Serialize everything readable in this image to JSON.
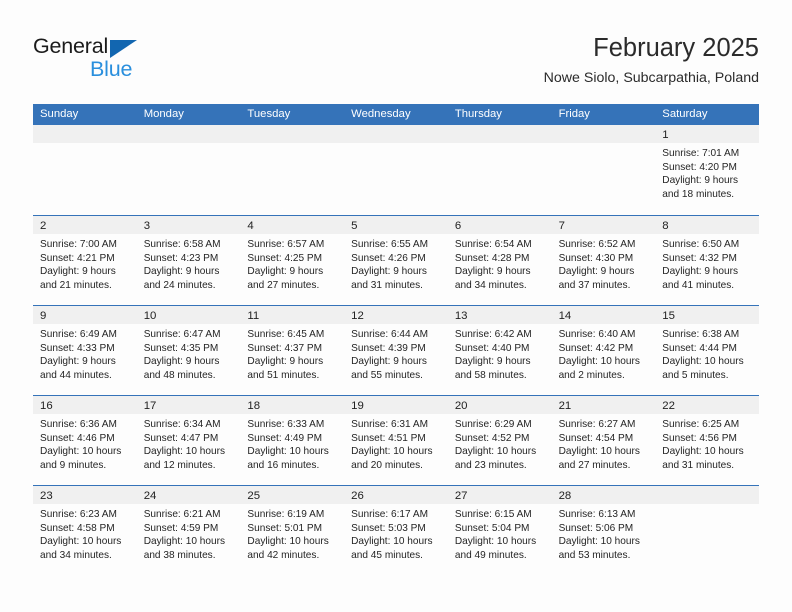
{
  "brand": {
    "name_primary": "General",
    "name_secondary": "Blue",
    "triangle_color": "#1266b0",
    "secondary_color": "#2a8fdd"
  },
  "header": {
    "title": "February 2025",
    "subtitle": "Nowe Siolo, Subcarpathia, Poland"
  },
  "theme": {
    "header_bg": "#3573b9",
    "header_text": "#ffffff",
    "daynum_band_bg": "#f0f0f0",
    "row_border": "#3573b9",
    "page_bg": "#fdfdfd",
    "body_text": "#242424"
  },
  "weekdays": [
    "Sunday",
    "Monday",
    "Tuesday",
    "Wednesday",
    "Thursday",
    "Friday",
    "Saturday"
  ],
  "weeks": [
    [
      {
        "day": "",
        "lines": []
      },
      {
        "day": "",
        "lines": []
      },
      {
        "day": "",
        "lines": []
      },
      {
        "day": "",
        "lines": []
      },
      {
        "day": "",
        "lines": []
      },
      {
        "day": "",
        "lines": []
      },
      {
        "day": "1",
        "lines": [
          "Sunrise: 7:01 AM",
          "Sunset: 4:20 PM",
          "Daylight: 9 hours",
          "and 18 minutes."
        ]
      }
    ],
    [
      {
        "day": "2",
        "lines": [
          "Sunrise: 7:00 AM",
          "Sunset: 4:21 PM",
          "Daylight: 9 hours",
          "and 21 minutes."
        ]
      },
      {
        "day": "3",
        "lines": [
          "Sunrise: 6:58 AM",
          "Sunset: 4:23 PM",
          "Daylight: 9 hours",
          "and 24 minutes."
        ]
      },
      {
        "day": "4",
        "lines": [
          "Sunrise: 6:57 AM",
          "Sunset: 4:25 PM",
          "Daylight: 9 hours",
          "and 27 minutes."
        ]
      },
      {
        "day": "5",
        "lines": [
          "Sunrise: 6:55 AM",
          "Sunset: 4:26 PM",
          "Daylight: 9 hours",
          "and 31 minutes."
        ]
      },
      {
        "day": "6",
        "lines": [
          "Sunrise: 6:54 AM",
          "Sunset: 4:28 PM",
          "Daylight: 9 hours",
          "and 34 minutes."
        ]
      },
      {
        "day": "7",
        "lines": [
          "Sunrise: 6:52 AM",
          "Sunset: 4:30 PM",
          "Daylight: 9 hours",
          "and 37 minutes."
        ]
      },
      {
        "day": "8",
        "lines": [
          "Sunrise: 6:50 AM",
          "Sunset: 4:32 PM",
          "Daylight: 9 hours",
          "and 41 minutes."
        ]
      }
    ],
    [
      {
        "day": "9",
        "lines": [
          "Sunrise: 6:49 AM",
          "Sunset: 4:33 PM",
          "Daylight: 9 hours",
          "and 44 minutes."
        ]
      },
      {
        "day": "10",
        "lines": [
          "Sunrise: 6:47 AM",
          "Sunset: 4:35 PM",
          "Daylight: 9 hours",
          "and 48 minutes."
        ]
      },
      {
        "day": "11",
        "lines": [
          "Sunrise: 6:45 AM",
          "Sunset: 4:37 PM",
          "Daylight: 9 hours",
          "and 51 minutes."
        ]
      },
      {
        "day": "12",
        "lines": [
          "Sunrise: 6:44 AM",
          "Sunset: 4:39 PM",
          "Daylight: 9 hours",
          "and 55 minutes."
        ]
      },
      {
        "day": "13",
        "lines": [
          "Sunrise: 6:42 AM",
          "Sunset: 4:40 PM",
          "Daylight: 9 hours",
          "and 58 minutes."
        ]
      },
      {
        "day": "14",
        "lines": [
          "Sunrise: 6:40 AM",
          "Sunset: 4:42 PM",
          "Daylight: 10 hours",
          "and 2 minutes."
        ]
      },
      {
        "day": "15",
        "lines": [
          "Sunrise: 6:38 AM",
          "Sunset: 4:44 PM",
          "Daylight: 10 hours",
          "and 5 minutes."
        ]
      }
    ],
    [
      {
        "day": "16",
        "lines": [
          "Sunrise: 6:36 AM",
          "Sunset: 4:46 PM",
          "Daylight: 10 hours",
          "and 9 minutes."
        ]
      },
      {
        "day": "17",
        "lines": [
          "Sunrise: 6:34 AM",
          "Sunset: 4:47 PM",
          "Daylight: 10 hours",
          "and 12 minutes."
        ]
      },
      {
        "day": "18",
        "lines": [
          "Sunrise: 6:33 AM",
          "Sunset: 4:49 PM",
          "Daylight: 10 hours",
          "and 16 minutes."
        ]
      },
      {
        "day": "19",
        "lines": [
          "Sunrise: 6:31 AM",
          "Sunset: 4:51 PM",
          "Daylight: 10 hours",
          "and 20 minutes."
        ]
      },
      {
        "day": "20",
        "lines": [
          "Sunrise: 6:29 AM",
          "Sunset: 4:52 PM",
          "Daylight: 10 hours",
          "and 23 minutes."
        ]
      },
      {
        "day": "21",
        "lines": [
          "Sunrise: 6:27 AM",
          "Sunset: 4:54 PM",
          "Daylight: 10 hours",
          "and 27 minutes."
        ]
      },
      {
        "day": "22",
        "lines": [
          "Sunrise: 6:25 AM",
          "Sunset: 4:56 PM",
          "Daylight: 10 hours",
          "and 31 minutes."
        ]
      }
    ],
    [
      {
        "day": "23",
        "lines": [
          "Sunrise: 6:23 AM",
          "Sunset: 4:58 PM",
          "Daylight: 10 hours",
          "and 34 minutes."
        ]
      },
      {
        "day": "24",
        "lines": [
          "Sunrise: 6:21 AM",
          "Sunset: 4:59 PM",
          "Daylight: 10 hours",
          "and 38 minutes."
        ]
      },
      {
        "day": "25",
        "lines": [
          "Sunrise: 6:19 AM",
          "Sunset: 5:01 PM",
          "Daylight: 10 hours",
          "and 42 minutes."
        ]
      },
      {
        "day": "26",
        "lines": [
          "Sunrise: 6:17 AM",
          "Sunset: 5:03 PM",
          "Daylight: 10 hours",
          "and 45 minutes."
        ]
      },
      {
        "day": "27",
        "lines": [
          "Sunrise: 6:15 AM",
          "Sunset: 5:04 PM",
          "Daylight: 10 hours",
          "and 49 minutes."
        ]
      },
      {
        "day": "28",
        "lines": [
          "Sunrise: 6:13 AM",
          "Sunset: 5:06 PM",
          "Daylight: 10 hours",
          "and 53 minutes."
        ]
      },
      {
        "day": "",
        "lines": []
      }
    ]
  ]
}
